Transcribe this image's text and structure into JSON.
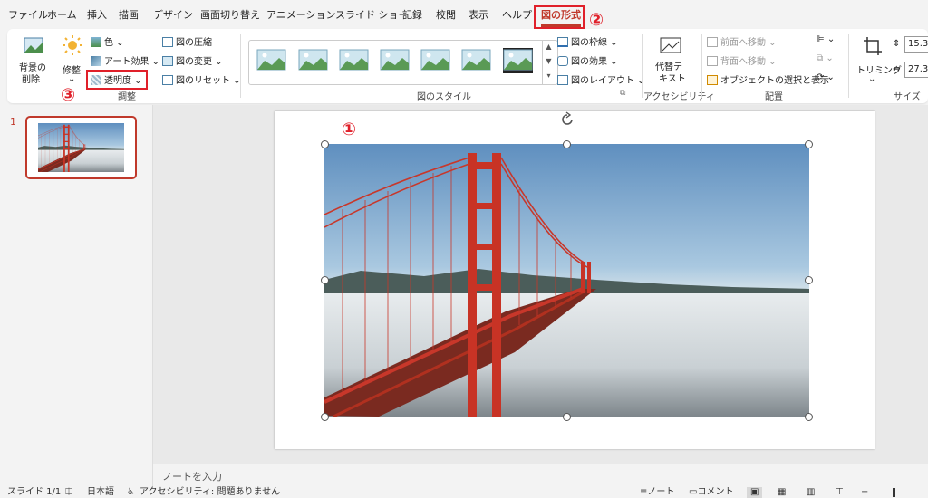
{
  "tabs": [
    "ファイル",
    "ホーム",
    "挿入",
    "描画",
    "デザイン",
    "画面切り替え",
    "アニメーション",
    "スライド ショー",
    "記録",
    "校閲",
    "表示",
    "ヘルプ",
    "図の形式"
  ],
  "active_tab": "図の形式",
  "markers": {
    "one": "①",
    "two": "②",
    "three": "③"
  },
  "ribbon": {
    "remove_bg": [
      "背景の",
      "削除"
    ],
    "corrections": "修整",
    "color": "色",
    "art_effects": "アート効果",
    "transparency": "透明度",
    "compress": "図の圧縮",
    "change": "図の変更",
    "reset": "図のリセット",
    "group_adjust": "調整",
    "border": "図の枠線",
    "effects": "図の効果",
    "layout": "図のレイアウト",
    "group_styles": "図のスタイル",
    "alt_text": [
      "代替テ",
      "キスト"
    ],
    "group_access": "アクセシビリティ",
    "bring_forward": "前面へ移動",
    "send_backward": "背面へ移動",
    "selection_pane": "オブジェクトの選択と表示",
    "group_arrange": "配置",
    "crop": "トリミング",
    "height": "15.3",
    "width": "27.3",
    "group_size": "サイズ"
  },
  "slide_number": "1",
  "notes_placeholder": "ノートを入力",
  "status": {
    "slide": "スライド 1/1",
    "language": "日本語",
    "accessibility": "アクセシビリティ: 問題ありません",
    "notes": "ノート",
    "comments": "コメント"
  },
  "colors": {
    "accent": "#c0392b",
    "marker": "#e0202a"
  }
}
